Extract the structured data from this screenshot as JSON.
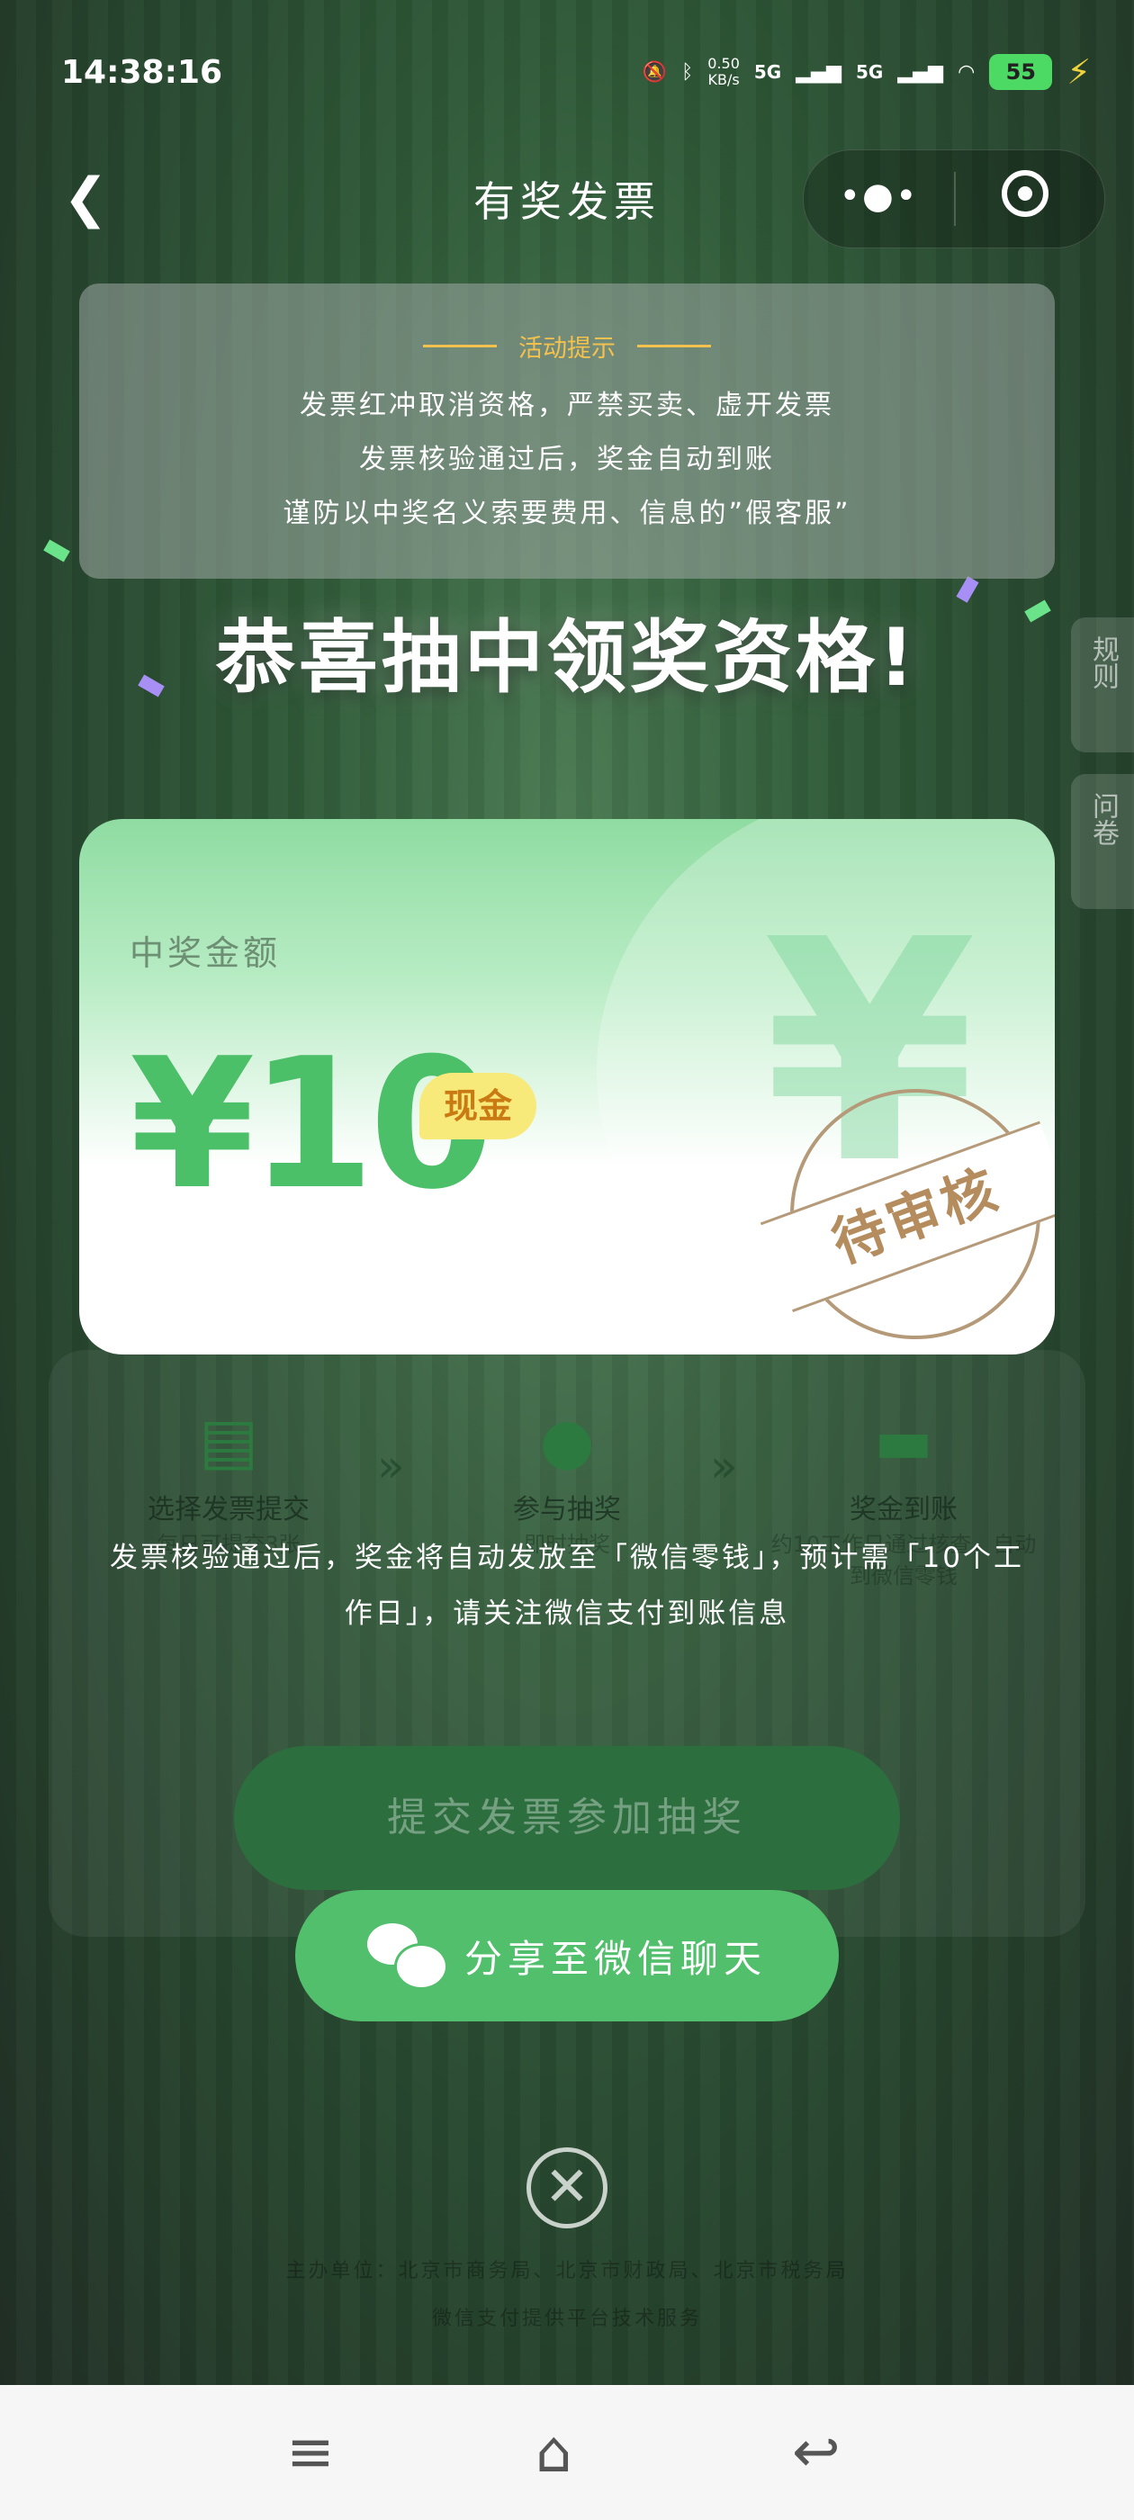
{
  "status_bar": {
    "time": "14:38:16",
    "net_speed_value": "0.50",
    "net_speed_unit": "KB/s",
    "signal_1": "5G",
    "signal_2": "5G",
    "battery": "55"
  },
  "nav": {
    "title": "有奖发票",
    "more_icon": "more-dots-icon",
    "close_icon": "target-icon"
  },
  "activity_tip": {
    "heading": "活动提示",
    "lines": [
      "发票红冲取消资格，严禁买卖、虚开发票",
      "发票核验通过后，奖金自动到账",
      "谨防以中奖名义索要费用、信息的”假客服”"
    ]
  },
  "congrats": "恭喜抽中领奖资格!",
  "side_tabs": {
    "rules": "规则",
    "survey": "问卷"
  },
  "prize_card": {
    "label": "中奖金额",
    "amount": "¥10",
    "type_badge": "现金",
    "background_symbol": "¥",
    "stamp": "待审核"
  },
  "steps": [
    {
      "title": "选择发票提交",
      "sub": "每日可提交3张",
      "icon": "document-check-icon"
    },
    {
      "title": "参与抽奖",
      "sub": "即时抽奖",
      "icon": "money-bag-icon"
    },
    {
      "title": "奖金到账",
      "sub": "约10工作日通过核查，自动到微信零钱",
      "icon": "wallet-icon"
    }
  ],
  "submit_button": "提交发票参加抽奖",
  "notice_line1": "发票核验通过后，奖金将自动发放至「微信零钱」，预计需「10个工",
  "notice_line2": "作日」，请关注微信支付到账信息",
  "share_button": "分享至微信聊天",
  "footer": {
    "organizer": "主办单位：北京市商务局、北京市财政局、北京市税务局",
    "support": "微信支付提供平台技术服务"
  },
  "colors": {
    "primary_green": "#52bf6c",
    "amount_green": "#4cbf69",
    "gold": "#f2c14e",
    "badge_yellow": "#f7e97a",
    "stamp_brown": "#b58c5e"
  }
}
